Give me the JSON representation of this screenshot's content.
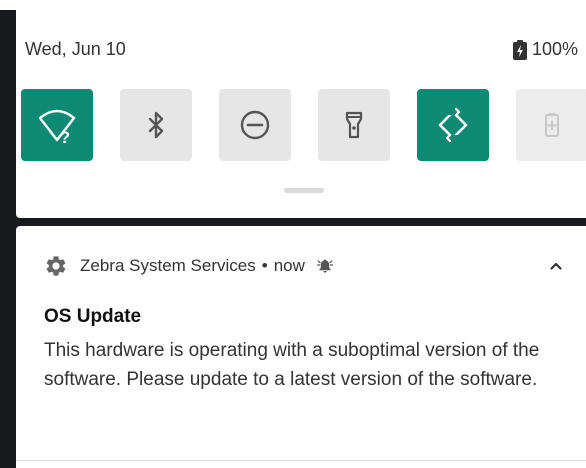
{
  "status_bar": {
    "date": "Wed, Jun 10",
    "battery_percent": "100%",
    "battery_icon": "battery-full-icon"
  },
  "quick_settings": {
    "tiles": [
      {
        "icon": "wifi-unknown-icon",
        "state": "on"
      },
      {
        "icon": "bluetooth-icon",
        "state": "off"
      },
      {
        "icon": "do-not-disturb-icon",
        "state": "off"
      },
      {
        "icon": "flashlight-icon",
        "state": "off"
      },
      {
        "icon": "auto-rotate-icon",
        "state": "on"
      },
      {
        "icon": "battery-saver-icon",
        "state": "disabled"
      }
    ],
    "active_color": "#0e8a74",
    "inactive_color": "#e6e6e6"
  },
  "notification": {
    "app_icon": "gear-icon",
    "app_name": "Zebra System Services",
    "separator": "•",
    "time": "now",
    "alert_icon": "bell-icon",
    "title": "OS Update",
    "body": "This hardware is operating with a suboptimal version of the software. Please update to a latest version of the software."
  }
}
